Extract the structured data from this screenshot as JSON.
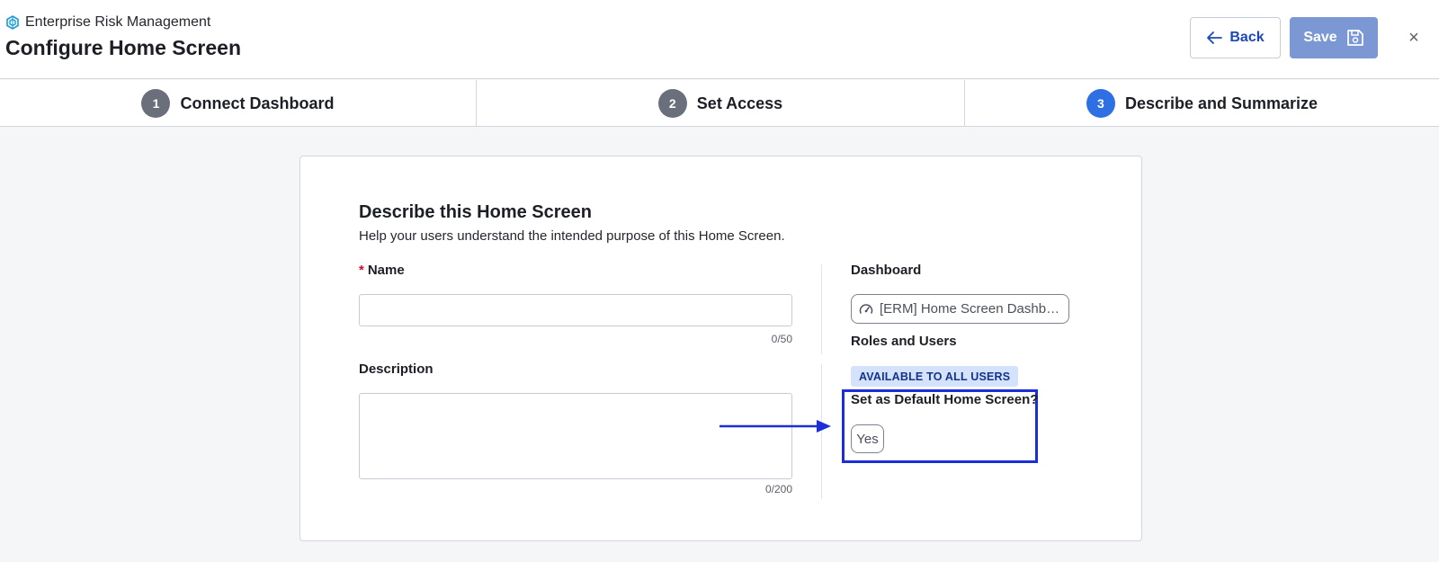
{
  "header": {
    "app_name": "Enterprise Risk Management",
    "title": "Configure Home Screen",
    "back_label": "Back",
    "save_label": "Save",
    "close_glyph": "×"
  },
  "steps": [
    {
      "number": "1",
      "label": "Connect Dashboard",
      "active": false
    },
    {
      "number": "2",
      "label": "Set Access",
      "active": false
    },
    {
      "number": "3",
      "label": "Describe and Summarize",
      "active": true
    }
  ],
  "form": {
    "title": "Describe this Home Screen",
    "subtitle": "Help your users understand the intended purpose of this Home Screen.",
    "name": {
      "required_mark": "*",
      "label": "Name",
      "value": "",
      "counter": "0/50"
    },
    "description": {
      "label": "Description",
      "value": "",
      "counter": "0/200"
    }
  },
  "summary": {
    "dashboard_label": "Dashboard",
    "dashboard_value": "[ERM] Home Screen Dashboard",
    "roles_label": "Roles and Users",
    "roles_badge": "AVAILABLE TO ALL USERS",
    "default_label": "Set as Default Home Screen?",
    "default_value": "Yes"
  },
  "colors": {
    "accent": "#2f6fe4",
    "link": "#1b47b8",
    "save_disabled": "#7b97d4",
    "highlight": "#1c2fd6",
    "badge_bg": "#d5e2fb"
  }
}
